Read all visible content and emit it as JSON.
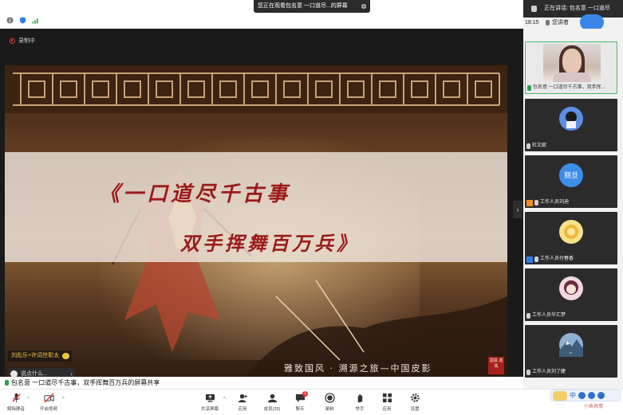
{
  "share_banner": {
    "text": "您正在观看包名意 一口道尽...的屏幕"
  },
  "recording": {
    "label": "录制中"
  },
  "video": {
    "line1": "《一口道尽千古事",
    "line2": "双手挥舞百万兵》",
    "subtitle": "雅致国风 · 溯源之旅—中国皮影",
    "seal": "國風 遇風"
  },
  "tip": {
    "text": "刘彪乐+许词世彰太"
  },
  "chat": {
    "placeholder": "说点什么..."
  },
  "caption": {
    "text": "包名意 一口道尽千古事，双手挥舞百万兵的屏幕共享"
  },
  "speaking": {
    "label": "正在讲话: 包名意 一口道尽"
  },
  "clock": {
    "time": "18:15",
    "speaker": "您讲者"
  },
  "participants": [
    {
      "name": "包名意 一口道尽千古事，双手挥..."
    },
    {
      "name": "杜文妮"
    },
    {
      "name": "工作人员刘迪",
      "avatar_text": "丽旦"
    },
    {
      "name": "工作人员付春香"
    },
    {
      "name": "工作人员华汇梦"
    },
    {
      "name": "工作人员刘了婕"
    }
  ],
  "toolbar": {
    "mute": "解除静音",
    "video": "开启视频",
    "share": "共享屏幕",
    "apps": "应用",
    "members": "成员(20)",
    "chat": "聊天",
    "chat_badge": "1",
    "record": "录制",
    "raise": "举手",
    "more": "应用",
    "settings": "设置"
  },
  "ime": {
    "mode": "中"
  },
  "watermark": {
    "text": "小鱼表情"
  },
  "colors": {
    "accent": "#3a86e8",
    "title_red": "#9b1b1b",
    "active_border": "#46b86b"
  }
}
